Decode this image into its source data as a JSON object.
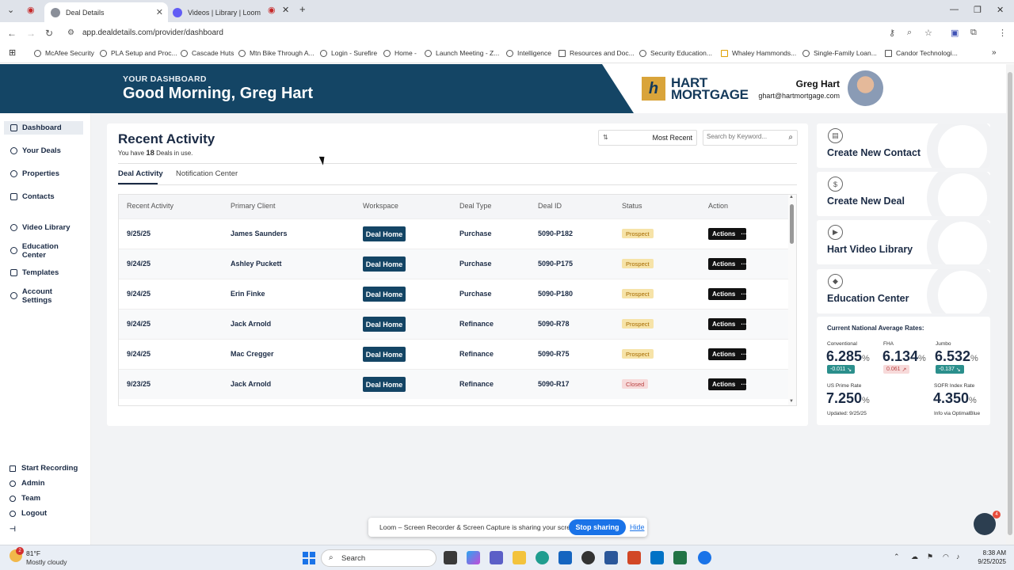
{
  "browser": {
    "tabs": [
      {
        "title": "Deal Details",
        "active": true
      },
      {
        "title": "Videos | Library | Loom",
        "active": false
      }
    ],
    "url": "app.dealdetails.com/provider/dashboard",
    "bookmarks": [
      "McAfee Security",
      "PLA Setup and Proc...",
      "Cascade Huts",
      "Mtn Bike Through A...",
      "Login - Surefire",
      "Home -",
      "Launch Meeting - Z...",
      "Intelligence",
      "Resources and Doc...",
      "Security Education...",
      "Whaley Hammonds...",
      "Single-Family Loan...",
      "Candor Technologi..."
    ]
  },
  "header": {
    "eyebrow": "YOUR DASHBOARD",
    "greeting": "Good Morning, Greg Hart",
    "logo_mark": "h",
    "logo_line1": "HART",
    "logo_line2": "MORTGAGE",
    "user_name": "Greg Hart",
    "user_email": "ghart@hartmortgage.com"
  },
  "sidebar": {
    "items": [
      {
        "label": "Dashboard"
      },
      {
        "label": "Your Deals"
      },
      {
        "label": "Properties"
      },
      {
        "label": "Contacts"
      },
      {
        "label": "Video Library"
      },
      {
        "label": "Education Center"
      },
      {
        "label": "Templates"
      },
      {
        "label": "Account Settings"
      }
    ],
    "bottom": [
      {
        "label": "Start Recording"
      },
      {
        "label": "Admin"
      },
      {
        "label": "Team"
      },
      {
        "label": "Logout"
      }
    ]
  },
  "activity": {
    "title": "Recent Activity",
    "sub_prefix": "You have",
    "deal_count": "18",
    "sub_suffix": "Deals in use.",
    "sort_value": "Most Recent",
    "search_placeholder": "Search by Keyword...",
    "tabs": [
      "Deal Activity",
      "Notification Center"
    ],
    "columns": [
      "Recent Activity",
      "Primary Client",
      "Workspace",
      "Deal Type",
      "Deal ID",
      "Status",
      "Action"
    ],
    "rows": [
      {
        "date": "9/25/25",
        "client": "James Saunders",
        "workspace": "Deal Home",
        "type": "Purchase",
        "id": "5090-P182",
        "status": "Prospect",
        "action": "Actions"
      },
      {
        "date": "9/24/25",
        "client": "Ashley Puckett",
        "workspace": "Deal Home",
        "type": "Purchase",
        "id": "5090-P175",
        "status": "Prospect",
        "action": "Actions"
      },
      {
        "date": "9/24/25",
        "client": "Erin Finke",
        "workspace": "Deal Home",
        "type": "Purchase",
        "id": "5090-P180",
        "status": "Prospect",
        "action": "Actions"
      },
      {
        "date": "9/24/25",
        "client": "Jack Arnold",
        "workspace": "Deal Home",
        "type": "Refinance",
        "id": "5090-R78",
        "status": "Prospect",
        "action": "Actions"
      },
      {
        "date": "9/24/25",
        "client": "Mac Cregger",
        "workspace": "Deal Home",
        "type": "Refinance",
        "id": "5090-R75",
        "status": "Prospect",
        "action": "Actions"
      },
      {
        "date": "9/23/25",
        "client": "Jack Arnold",
        "workspace": "Deal Home",
        "type": "Refinance",
        "id": "5090-R17",
        "status": "Closed",
        "action": "Actions"
      }
    ],
    "status_colors": {
      "Prospect": "#f6e3a8",
      "Closed": "#f7dada"
    }
  },
  "quick_actions": [
    "Create New Contact",
    "Create New Deal",
    "Hart Video Library",
    "Education Center"
  ],
  "rates": {
    "title": "Current National Average Rates:",
    "conventional": {
      "label": "Conventional",
      "value": "6.285",
      "change": "-0.011"
    },
    "fha": {
      "label": "FHA",
      "value": "6.134",
      "change": "0.061"
    },
    "jumbo": {
      "label": "Jumbo",
      "value": "6.532",
      "change": "-0.137"
    },
    "prime": {
      "label": "US Prime Rate",
      "value": "7.250"
    },
    "sofr": {
      "label": "SOFR Index Rate",
      "value": "4.350"
    },
    "pct": "%",
    "updated": "Updated: 9/25/25",
    "source": "Info via OptimalBlue"
  },
  "loom": {
    "message": "Loom – Screen Recorder & Screen Capture is sharing your screen.",
    "stop_label": "Stop sharing",
    "hide_label": "Hide"
  },
  "chat": {
    "count": "4"
  },
  "taskbar": {
    "temp": "81°F",
    "weather": "Mostly cloudy",
    "weather_alert": "2",
    "search_label": "Search",
    "time": "8:38 AM",
    "date": "9/25/2025"
  }
}
